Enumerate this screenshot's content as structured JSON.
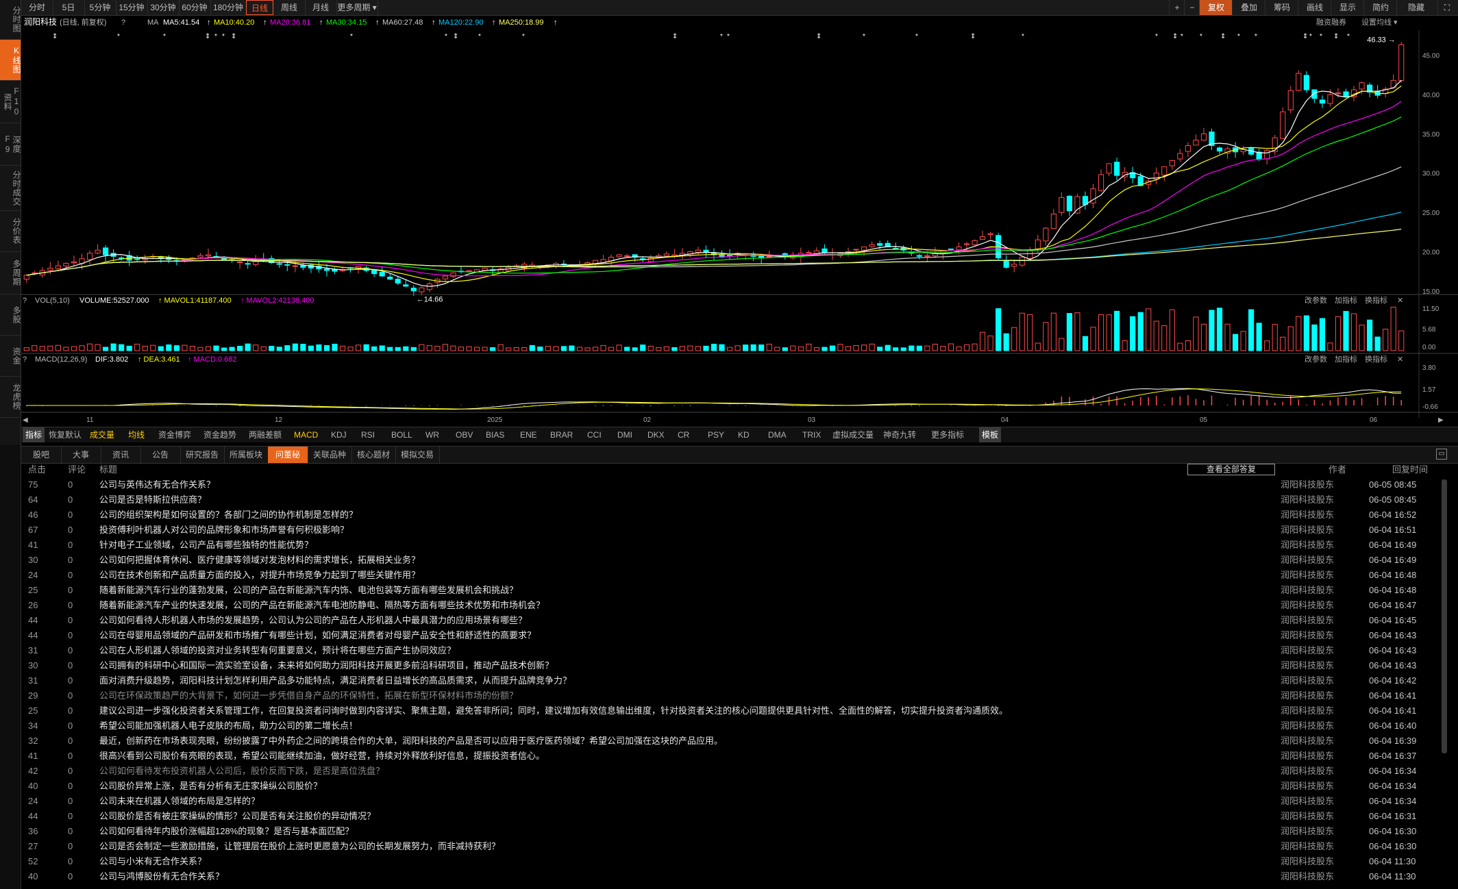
{
  "left_nav": {
    "items": [
      {
        "label": "分时图",
        "active": false
      },
      {
        "label": "K线图",
        "active": true
      },
      {
        "label": "F10资料",
        "active": false
      },
      {
        "label": "深度F9",
        "active": false
      },
      {
        "label": "分时成交",
        "active": false
      },
      {
        "label": "分价表",
        "active": false
      },
      {
        "label": "多周期",
        "active": false
      },
      {
        "label": "多股",
        "active": false
      },
      {
        "label": "资金",
        "active": false
      },
      {
        "label": "龙虎榜",
        "active": false
      }
    ]
  },
  "period_bar": {
    "tabs": [
      "分时",
      "5日",
      "5分钟",
      "15分钟",
      "30分钟",
      "60分钟",
      "180分钟",
      "日线",
      "周线",
      "月线",
      "更多周期"
    ],
    "active": "日线",
    "right_buttons": [
      "+",
      "−",
      "复权",
      "叠加",
      "筹码",
      "画线",
      "显示",
      "简约",
      "隐藏"
    ]
  },
  "main_chart": {
    "stock_name": "润阳科技",
    "period_label": "(日线, 前复权)",
    "q_mark": "?",
    "ma_label": "MA",
    "ma_values": [
      {
        "label": "MA5:41.54",
        "color": "#ffffff"
      },
      {
        "label": "MA10:40.20",
        "color": "#ffff00"
      },
      {
        "label": "MA20:36.81",
        "color": "#ff00ff"
      },
      {
        "label": "MA30:34.15",
        "color": "#00ff00"
      },
      {
        "label": "MA60:27.48",
        "color": "#cccccc"
      },
      {
        "label": "MA120:22.90",
        "color": "#00ccff"
      },
      {
        "label": "MA250:18.99",
        "color": "#ffff66"
      }
    ],
    "right_links": [
      "融资融券",
      "设置均线"
    ],
    "high_label": "46.33",
    "low_label": "14.66",
    "y_ticks": [
      "45.00",
      "40.00",
      "35.00",
      "30.00",
      "25.00",
      "20.00",
      "15.00"
    ]
  },
  "volume_panel": {
    "title": "VOL(5,10)",
    "volume": "VOLUME:52527.000",
    "mavol1": "MAVOL1:41187.400",
    "mavol2": "MAVOL2:42138.400",
    "links": [
      "改参数",
      "加指标",
      "换指标"
    ],
    "y_ticks": [
      "11.50",
      "5.68",
      "0.00"
    ]
  },
  "macd_panel": {
    "title": "MACD(12,26,9)",
    "dif": "DIF:3.802",
    "dea": "DEA:3.461",
    "macd": "MACD:0.682",
    "links": [
      "改参数",
      "加指标",
      "换指标"
    ],
    "y_ticks": [
      "3.80",
      "1.57",
      "-0.66"
    ]
  },
  "x_axis": [
    "11",
    "12",
    "2025",
    "02",
    "03",
    "04",
    "05",
    "06"
  ],
  "indicator_bar": {
    "items": [
      "指标",
      "恢复默认",
      "成交量",
      "均线",
      "资金博弈",
      "资金趋势",
      "两融差额",
      "MACD",
      "KDJ",
      "RSI",
      "BOLL",
      "WR",
      "OBV",
      "BIAS",
      "ENE",
      "BRAR",
      "CCI",
      "DMI",
      "DKX",
      "CR",
      "PSY",
      "KD",
      "DMA",
      "TRIX",
      "虚拟成交量",
      "神奇九转",
      "更多指标",
      "模板"
    ]
  },
  "info_tabs": {
    "items": [
      "股吧",
      "大事",
      "资讯",
      "公告",
      "研究报告",
      "所属板块",
      "问董秘",
      "关联品种",
      "核心题材",
      "模拟交易"
    ],
    "active": "问董秘"
  },
  "qa_table": {
    "headers": {
      "clicks": "点击",
      "comments": "评论",
      "title": "标题",
      "author": "作者",
      "reply_time": "回复时间"
    },
    "view_all": "查看全部答复",
    "rows": [
      {
        "clicks": "75",
        "comments": "0",
        "title": "公司与英伟达有无合作关系？",
        "author": "润阳科技股东",
        "time": "06-05 08:45"
      },
      {
        "clicks": "64",
        "comments": "0",
        "title": "公司是否是特斯拉供应商？",
        "author": "润阳科技股东",
        "time": "06-05 08:45"
      },
      {
        "clicks": "46",
        "comments": "0",
        "title": "公司的组织架构是如何设置的？各部门之间的协作机制是怎样的？",
        "author": "润阳科技股东",
        "time": "06-04 16:52"
      },
      {
        "clicks": "67",
        "comments": "0",
        "title": "投资傅利叶机器人对公司的品牌形象和市场声誉有何积极影响？",
        "author": "润阳科技股东",
        "time": "06-04 16:51"
      },
      {
        "clicks": "41",
        "comments": "0",
        "title": "针对电子工业领域，公司产品有哪些独特的性能优势？",
        "author": "润阳科技股东",
        "time": "06-04 16:49"
      },
      {
        "clicks": "30",
        "comments": "0",
        "title": "公司如何把握体育休闲、医疗健康等领域对发泡材料的需求增长，拓展相关业务？",
        "author": "润阳科技股东",
        "time": "06-04 16:49"
      },
      {
        "clicks": "24",
        "comments": "0",
        "title": "公司在技术创新和产品质量方面的投入，对提升市场竞争力起到了哪些关键作用？",
        "author": "润阳科技股东",
        "time": "06-04 16:48"
      },
      {
        "clicks": "25",
        "comments": "0",
        "title": "随着新能源汽车行业的蓬勃发展，公司的产品在新能源汽车内饰、电池包装等方面有哪些发展机会和挑战？",
        "author": "润阳科技股东",
        "time": "06-04 16:48"
      },
      {
        "clicks": "26",
        "comments": "0",
        "title": "随着新能源汽车产业的快速发展，公司的产品在新能源汽车电池防静电、隔热等方面有哪些技术优势和市场机会？",
        "author": "润阳科技股东",
        "time": "06-04 16:47"
      },
      {
        "clicks": "44",
        "comments": "0",
        "title": "公司如何看待人形机器人市场的发展趋势，公司认为公司的产品在人形机器人中最具潜力的应用场景有哪些？",
        "author": "润阳科技股东",
        "time": "06-04 16:45"
      },
      {
        "clicks": "44",
        "comments": "0",
        "title": "公司在母婴用品领域的产品研发和市场推广有哪些计划，如何满足消费者对母婴产品安全性和舒适性的高要求？",
        "author": "润阳科技股东",
        "time": "06-04 16:43"
      },
      {
        "clicks": "31",
        "comments": "0",
        "title": "公司在人形机器人领域的投资对业务转型有何重要意义，预计将在哪些方面产生协同效应？",
        "author": "润阳科技股东",
        "time": "06-04 16:43"
      },
      {
        "clicks": "30",
        "comments": "0",
        "title": "公司拥有的科研中心和国际一流实验室设备，未来将如何助力润阳科技开展更多前沿科研项目，推动产品技术创新？",
        "author": "润阳科技股东",
        "time": "06-04 16:43"
      },
      {
        "clicks": "31",
        "comments": "0",
        "title": "面对消费升级趋势，润阳科技计划怎样利用产品多功能特点，满足消费者日益增长的高品质需求，从而提升品牌竞争力？",
        "author": "润阳科技股东",
        "time": "06-04 16:42"
      },
      {
        "clicks": "29",
        "comments": "0",
        "title": "公司在环保政策趋严的大背景下，如何进一步凭借自身产品的环保特性，拓展在新型环保材料市场的份额？",
        "author": "润阳科技股东",
        "time": "06-04 16:41",
        "dim": true
      },
      {
        "clicks": "25",
        "comments": "0",
        "title": "建议公司进一步强化投资者关系管理工作，在回复投资者问询时做到内容详实、聚焦主题，避免答非所问；同时，建议增加有效信息输出维度，针对投资者关注的核心问题提供更具针对性、全面性的解答，切实提升投资者沟通质效。",
        "author": "润阳科技股东",
        "time": "06-04 16:41"
      },
      {
        "clicks": "34",
        "comments": "0",
        "title": "希望公司能加强机器人电子皮肤的布局，助力公司的第二增长点！",
        "author": "润阳科技股东",
        "time": "06-04 16:40"
      },
      {
        "clicks": "32",
        "comments": "0",
        "title": "最近，创新药在市场表现亮眼，纷纷披露了中外药企之间的跨境合作的大单，润阳科技的产品是否可以应用于医疗医药领域？希望公司加强在这块的产品应用。",
        "author": "润阳科技股东",
        "time": "06-04 16:39"
      },
      {
        "clicks": "41",
        "comments": "0",
        "title": "很高兴看到公司股价有亮眼的表现，希望公司能继续加油，做好经营，持续对外释放利好信息，提振投资者信心。",
        "author": "润阳科技股东",
        "time": "06-04 16:37"
      },
      {
        "clicks": "42",
        "comments": "0",
        "title": "公司如何看待发布投资机器人公司后，股价反而下跌，是否是高位洗盘？",
        "author": "润阳科技股东",
        "time": "06-04 16:34",
        "dim": true
      },
      {
        "clicks": "40",
        "comments": "0",
        "title": "公司股价异常上涨，是否有分析有无庄家操纵公司股价？",
        "author": "润阳科技股东",
        "time": "06-04 16:34"
      },
      {
        "clicks": "24",
        "comments": "0",
        "title": "公司未来在机器人领域的布局是怎样的？",
        "author": "润阳科技股东",
        "time": "06-04 16:34"
      },
      {
        "clicks": "44",
        "comments": "0",
        "title": "公司股价是否有被庄家操纵的情形？公司是否有关注股价的异动情况？",
        "author": "润阳科技股东",
        "time": "06-04 16:31"
      },
      {
        "clicks": "36",
        "comments": "0",
        "title": "公司如何看待年内股价涨幅超128%的现象？是否与基本面匹配？",
        "author": "润阳科技股东",
        "time": "06-04 16:30"
      },
      {
        "clicks": "27",
        "comments": "0",
        "title": "公司是否会制定一些激励措施，让管理层在股价上涨时更愿意为公司的长期发展努力，而非减持获利？",
        "author": "润阳科技股东",
        "time": "06-04 16:30"
      },
      {
        "clicks": "52",
        "comments": "0",
        "title": "公司与小米有无合作关系？",
        "author": "润阳科技股东",
        "time": "06-04 11:30"
      },
      {
        "clicks": "40",
        "comments": "0",
        "title": "公司与鸿博股份有无合作关系？",
        "author": "润阳科技股东",
        "time": "06-04 11:30"
      }
    ]
  },
  "chart_data": {
    "type": "candlestick",
    "title": "润阳科技 (日线, 前复权)",
    "ylim": [
      13.5,
      47.5
    ],
    "x_month_labels": [
      "11",
      "12",
      "2025",
      "02",
      "03",
      "04",
      "05",
      "06"
    ],
    "ohlc_key_points": [
      {
        "label": "period_start",
        "close": 17.0
      },
      {
        "label": "2025-01 low",
        "low": 14.66
      },
      {
        "label": "2025-04 dip",
        "close": 18.0
      },
      {
        "label": "2025-05 high zone",
        "close": 35.0
      },
      {
        "label": "2025-06 last",
        "close": 46.33,
        "high": 46.33
      }
    ],
    "close_series": [
      17.0,
      17.3,
      17.6,
      17.9,
      18.2,
      18.5,
      18.7,
      19.1,
      19.8,
      20.2,
      19.6,
      19.4,
      19.2,
      18.9,
      19.0,
      19.1,
      19.4,
      19.2,
      19.0,
      18.8,
      19.0,
      19.2,
      19.5,
      19.6,
      19.3,
      19.0,
      18.9,
      18.7,
      18.4,
      18.8,
      19.0,
      18.6,
      18.4,
      18.3,
      18.2,
      18.0,
      17.9,
      17.8,
      17.6,
      17.5,
      17.7,
      17.9,
      18.1,
      17.6,
      17.2,
      16.9,
      16.5,
      16.0,
      15.6,
      15.0,
      15.4,
      15.9,
      16.5,
      16.9,
      17.3,
      17.5,
      17.6,
      17.7,
      17.9,
      17.6,
      17.8,
      18.0,
      18.2,
      18.4,
      18.3,
      18.1,
      18.3,
      18.5,
      18.4,
      18.2,
      18.3,
      18.6,
      18.9,
      19.0,
      19.3,
      19.6,
      19.5,
      19.3,
      19.0,
      19.2,
      19.5,
      19.7,
      19.6,
      19.8,
      20.0,
      20.2,
      19.9,
      19.6,
      19.3,
      19.5,
      19.8,
      19.6,
      19.4,
      19.2,
      19.4,
      19.5,
      19.4,
      19.6,
      19.8,
      19.9,
      20.1,
      19.9,
      19.7,
      19.8,
      20.0,
      20.3,
      20.6,
      20.9,
      20.8,
      20.6,
      20.4,
      20.2,
      19.8,
      19.4,
      19.5,
      19.8,
      20.1,
      20.3,
      20.6,
      21.0,
      21.4,
      21.9,
      22.3,
      19.2,
      18.0,
      18.4,
      19.3,
      20.1,
      21.5,
      23.0,
      24.8,
      26.9,
      25.2,
      27.0,
      26.0,
      28.0,
      29.8,
      31.2,
      29.7,
      30.1,
      29.4,
      28.4,
      29.0,
      30.0,
      30.8,
      31.6,
      32.5,
      33.5,
      34.2,
      35.0,
      33.5,
      32.8,
      33.1,
      32.7,
      33.0,
      32.4,
      31.8,
      32.9,
      34.5,
      37.8,
      40.5,
      42.7,
      40.6,
      39.5,
      38.9,
      40.0,
      40.2,
      39.7,
      40.6,
      41.5,
      40.3,
      39.9,
      40.7,
      41.8,
      46.33
    ]
  }
}
